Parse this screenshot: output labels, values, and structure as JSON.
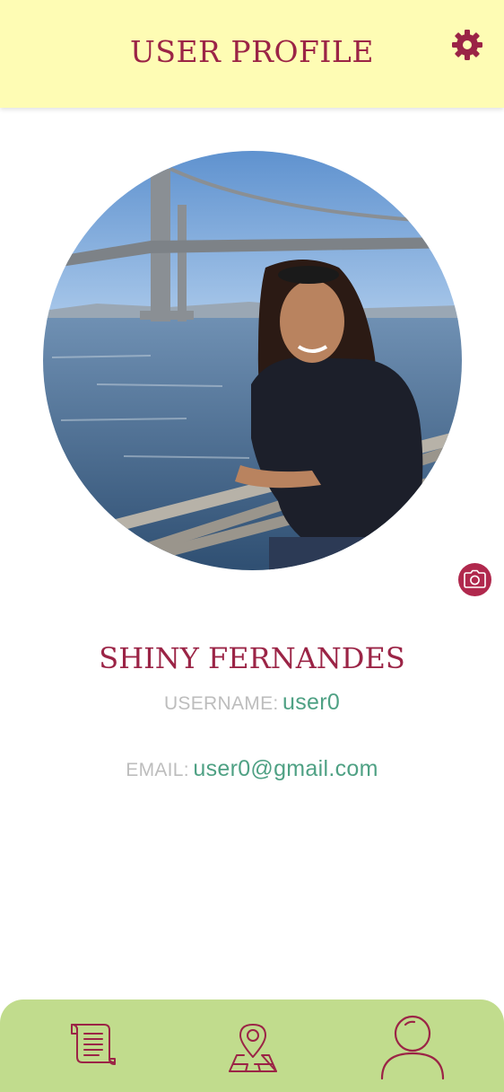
{
  "header": {
    "title": "USER PROFILE",
    "settings_icon": "gear-icon"
  },
  "profile": {
    "photo": "profile-photo",
    "change_photo_icon": "camera-icon",
    "full_name": "SHINY FERNANDES",
    "username_label": "USERNAME:",
    "username_value": "user0",
    "email_label": "EMAIL:",
    "email_value": "user0@gmail.com"
  },
  "bottom_nav": {
    "items": [
      {
        "icon": "scroll-icon",
        "active": false
      },
      {
        "icon": "map-pin-icon",
        "active": false
      },
      {
        "icon": "user-icon",
        "active": true
      }
    ]
  },
  "colors": {
    "header_bg": "#fefcb4",
    "accent": "#9b2446",
    "value_text": "#4fa184",
    "label_text": "#bdbdbd",
    "nav_bg": "#c1dc8d"
  }
}
